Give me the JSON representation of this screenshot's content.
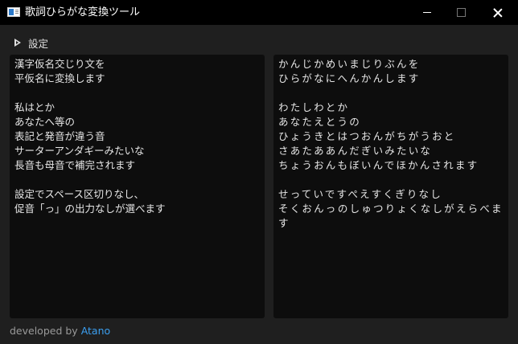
{
  "window": {
    "title": "歌詞ひらがな変換ツール"
  },
  "toolbar": {
    "settings_label": "設定"
  },
  "input_panel": {
    "text": "漢字仮名交じり文を\n平仮名に変換します\n\n私はとか\nあなたへ等の\n表記と発音が違う音\nサーターアンダギーみたいな\n長音も母音で補完されます\n\n設定でスペース区切りなし、\n促音「っ」の出力なしが選べます"
  },
  "output_panel": {
    "text": "かんじかめいまじりぶんを\nひらがなにへんかんします\n\nわたしわとか\nあなたえとうの\nひょうきとはつおんがちがうおと\nさあたああんだぎいみたいな\nちょうおんもぼいんでほかんされます\n\nせっていですぺえすくぎりなし\nそくおんっのしゅつりょくなしがえらべます"
  },
  "footer": {
    "prefix": "developed by",
    "author": "Atano"
  },
  "colors": {
    "titlebar": "#000000",
    "background": "#1f1f1f",
    "panel": "#0d0d0d",
    "text": "#e6e6e6",
    "link": "#3b9ff0"
  }
}
